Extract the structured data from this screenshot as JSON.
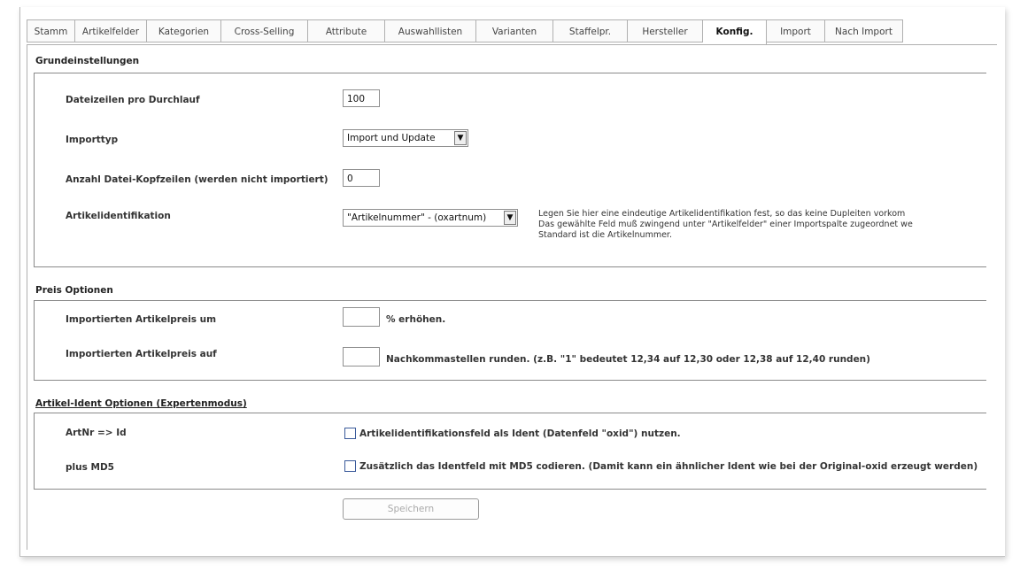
{
  "tabs": [
    {
      "label": "Stamm"
    },
    {
      "label": "Artikelfelder"
    },
    {
      "label": "Kategorien"
    },
    {
      "label": "Cross-Selling"
    },
    {
      "label": "Attribute"
    },
    {
      "label": "Auswahllisten"
    },
    {
      "label": "Varianten"
    },
    {
      "label": "Staffelpr."
    },
    {
      "label": "Hersteller"
    },
    {
      "label": "Konfig."
    },
    {
      "label": "Import"
    },
    {
      "label": "Nach Import"
    }
  ],
  "grund": {
    "title": "Grundeinstellungen",
    "dateizeilen_label": "Dateizeilen pro Durchlauf",
    "dateizeilen_value": "100",
    "importtyp_label": "Importtyp",
    "importtyp_value": "Import und Update",
    "kopfzeilen_label": "Anzahl Datei-Kopfzeilen (werden nicht importiert)",
    "kopfzeilen_value": "0",
    "ident_label": "Artikelidentifikation",
    "ident_value": "\"Artikelnummer\" - (oxartnum)",
    "hint_line1": "Legen Sie hier eine eindeutige Artikelidentifikation fest, so das keine Dupleiten vorkom",
    "hint_line2": "Das gewählte Feld muß zwingend unter \"Artikelfelder\" einer Importspalte zugeordnet we",
    "hint_line3": "Standard ist die Artikelnummer."
  },
  "preis": {
    "title": "Preis Optionen",
    "erhoehen_label": "Importierten Artikelpreis um",
    "erhoehen_suffix": "% erhöhen.",
    "runden_label": "Importierten Artikelpreis auf",
    "runden_suffix": "Nachkommastellen runden. (z.B. \"1\" bedeutet 12,34 auf 12,30 oder 12,38 auf 12,40 runden)"
  },
  "ident_opt": {
    "title": "Artikel-Ident Optionen (Expertenmodus)",
    "artnr_label": "ArtNr => Id",
    "artnr_text": "Artikelidentifikationsfeld als Ident (Datenfeld \"oxid\") nutzen.",
    "md5_label": "plus MD5",
    "md5_text": "Zusätzlich das Identfeld mit MD5 codieren. (Damit kann ein ähnlicher Ident wie bei der Original-oxid erzeugt werden)"
  },
  "save_label": "Speichern"
}
